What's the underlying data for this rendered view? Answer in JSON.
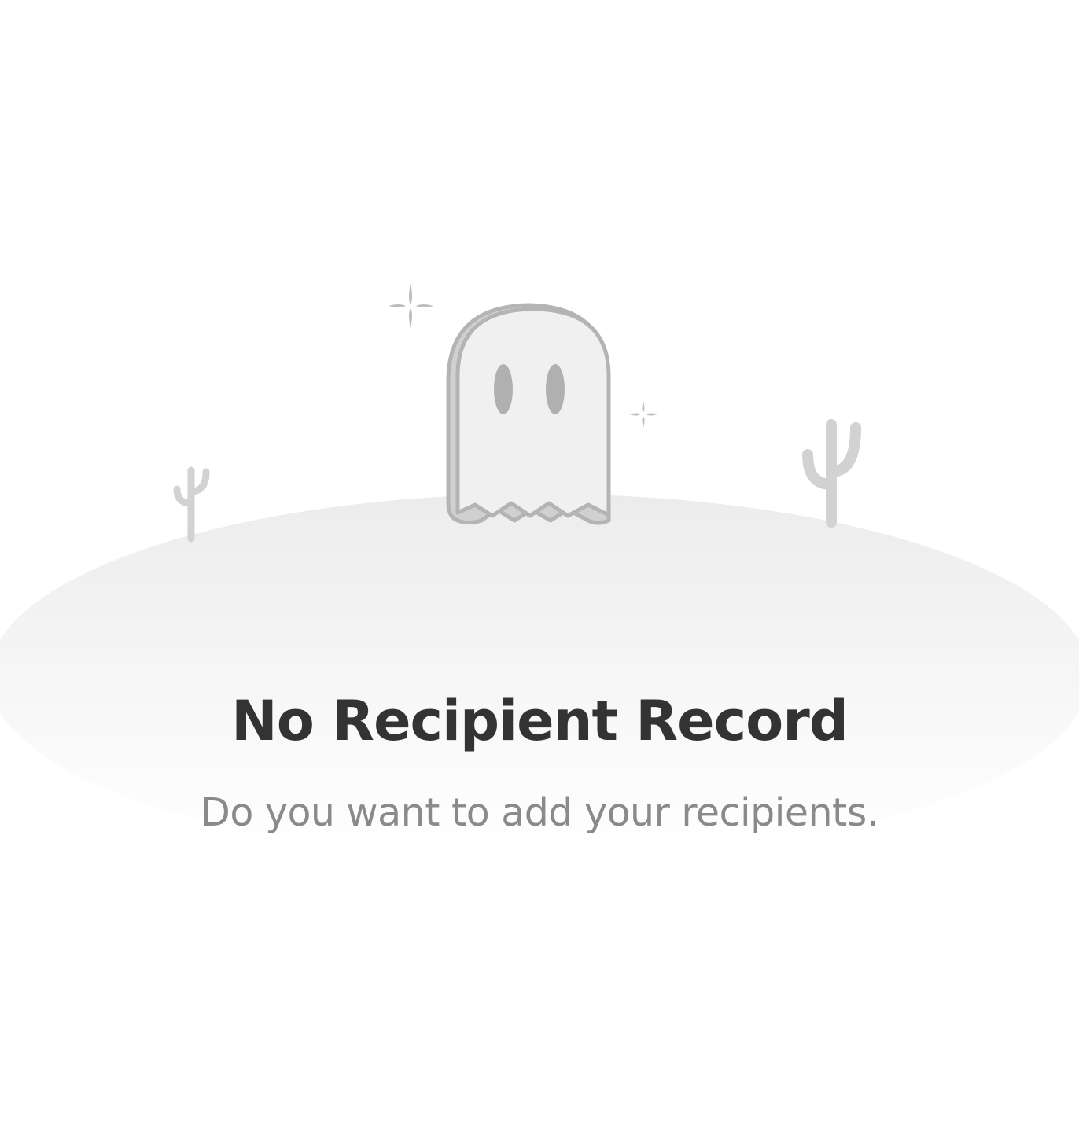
{
  "empty_state": {
    "title": "No Recipient Record",
    "subtitle": "Do you want to add your recipients.",
    "illustration_icon": "ghost-desert-icon"
  },
  "colors": {
    "title": "#333333",
    "subtitle": "#8a8a8a",
    "illustration_fill": "#f0f0f0",
    "illustration_stroke": "#b4b4b4",
    "ghost_eyes": "#b0b0b0"
  }
}
